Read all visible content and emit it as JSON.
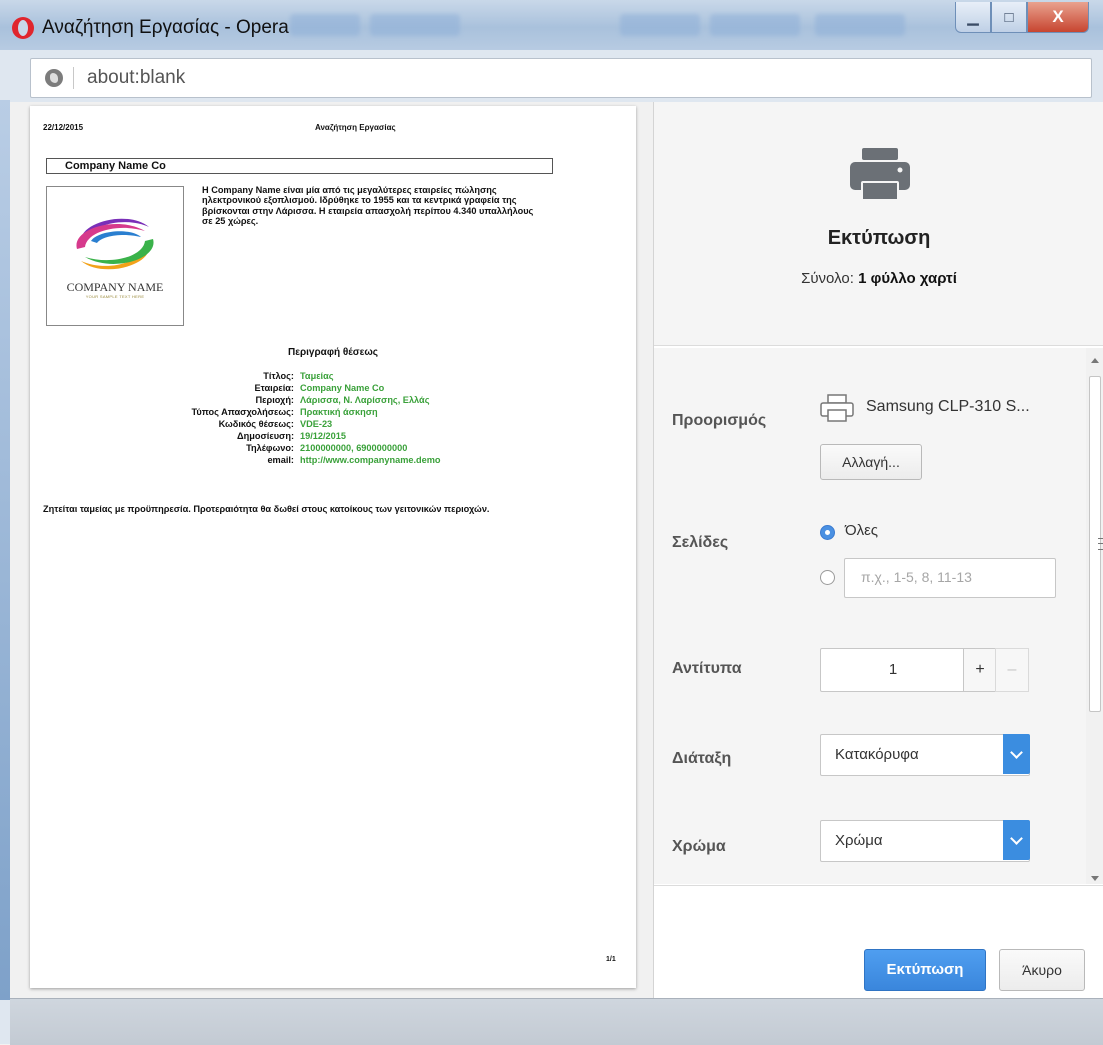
{
  "window": {
    "title": "Αναζήτηση Εργασίας - Opera",
    "controls": {
      "minimize": "▁",
      "maximize": "□",
      "close": "X"
    }
  },
  "address": {
    "url": "about:blank"
  },
  "preview": {
    "date": "22/12/2015",
    "header": "Αναζήτηση Εργασίας",
    "company_name": "Company Name Co",
    "logo_text": "COMPANY NAME",
    "logo_tagline": "YOUR SAMPLE TEXT HERE",
    "description": "Η Company Name είναι μία από τις μεγαλύτερες εταιρείες πώλησης ηλεκτρονικού εξοπλισμού. Ιδρύθηκε το 1955 και τα κεντρικά γραφεία της βρίσκονται στην Λάρισσα. Η εταιρεία απασχολή περίπου 4.340 υπαλλήλους σε 25 χώρες.",
    "section_title": "Περιγραφή θέσεως",
    "details": [
      {
        "label": "Τίτλος:",
        "value": "Ταμείας"
      },
      {
        "label": "Εταιρεία:",
        "value": "Company Name Co"
      },
      {
        "label": "Περιοχή:",
        "value": "Λάρισσα, Ν. Λαρίσσης, Ελλάς"
      },
      {
        "label": "Τύπος Απασχολήσεως:",
        "value": "Πρακτική άσκηση"
      },
      {
        "label": "Κωδικός θέσεως:",
        "value": "VDE-23"
      },
      {
        "label": "Δημοσίευση:",
        "value": "19/12/2015"
      },
      {
        "label": "Τηλέφωνο:",
        "value": "2100000000, 6900000000"
      },
      {
        "label": "email:",
        "value": "http://www.companyname.demo"
      }
    ],
    "footer_text": "Ζητείται ταμείας με προϋπηρεσία. Προτεραιότητα θα δωθεί στους κατοίκους των γειτονικών περιοχών.",
    "page_number": "1/1"
  },
  "print_panel": {
    "title": "Εκτύπωση",
    "total_label": "Σύνολο:",
    "total_value": "1 φύλλο χαρτί",
    "destination_label": "Προορισμός",
    "destination_name": "Samsung CLP-310 S...",
    "change_button": "Αλλαγή...",
    "pages_label": "Σελίδες",
    "pages_all": "Όλες",
    "pages_placeholder": "π.χ., 1-5, 8, 11-13",
    "copies_label": "Αντίτυπα",
    "copies_value": "1",
    "plus": "+",
    "minus": "–",
    "layout_label": "Διάταξη",
    "layout_value": "Κατακόρυφα",
    "color_label": "Χρώμα",
    "color_value": "Χρώμα",
    "print_button": "Εκτύπωση",
    "cancel_button": "Άκυρο"
  },
  "icons": [
    "opera-icon",
    "globe-icon",
    "printer-icon",
    "printer-outline-icon",
    "chevron-down-icon"
  ],
  "colors": {
    "accent": "#3b8de0",
    "detail_values": "#3aa13a",
    "close": "#c74530"
  }
}
